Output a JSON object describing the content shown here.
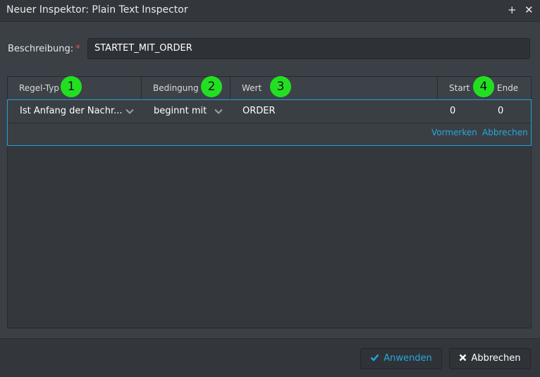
{
  "window": {
    "title": "Neuer Inspektor: Plain Text Inspector",
    "add_icon": "plus-icon",
    "close_icon": "close-icon"
  },
  "form": {
    "description_label": "Beschreibung:",
    "required_marker": "*",
    "description_value": "STARTET_MIT_ORDER"
  },
  "table": {
    "columns": {
      "rule_type": "Regel-Typ",
      "condition": "Bedingung",
      "value": "Wert",
      "start": "Start",
      "end": "Ende"
    },
    "edit_row": {
      "rule_type": "Ist Anfang der Nachr...",
      "condition": "beginnt mit",
      "value": "ORDER",
      "start": "0",
      "end": "0"
    },
    "row_actions": {
      "save": "Vormerken",
      "cancel": "Abbrechen"
    }
  },
  "badges": [
    "1",
    "2",
    "3",
    "4"
  ],
  "footer": {
    "apply": {
      "label": "Anwenden",
      "icon": "check-icon"
    },
    "cancel": {
      "label": "Abbrechen",
      "icon": "x-icon"
    }
  },
  "colors": {
    "accent": "#27a8df",
    "badge": "#22e021",
    "required": "#e05252"
  }
}
